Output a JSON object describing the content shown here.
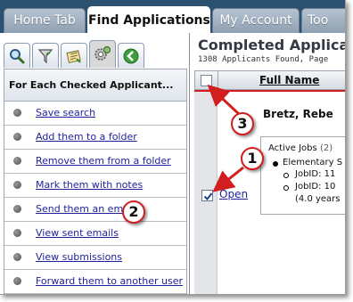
{
  "tabs": [
    {
      "label": "Home Tab",
      "active": false
    },
    {
      "label": "Find Applications",
      "active": true
    },
    {
      "label": "My Account",
      "active": false
    },
    {
      "label": "Too",
      "active": false
    }
  ],
  "toolbar_icons": [
    "search-icon",
    "filter-icon",
    "notes-icon",
    "gears-icon",
    "back-arrow-icon"
  ],
  "panel": {
    "heading": "For Each Checked Applicant...",
    "actions": [
      {
        "label": "Save search"
      },
      {
        "label": "Add them to a folder"
      },
      {
        "label": "Remove them from a folder"
      },
      {
        "label": "Mark them with notes"
      },
      {
        "label": "Send them an email"
      },
      {
        "label": "View sent emails"
      },
      {
        "label": "View submissions"
      },
      {
        "label": "Forward them to another user"
      }
    ]
  },
  "main": {
    "title": "Completed Applicat",
    "subtitle": "1308 Applicants Found, Page",
    "column_header": "Full Name",
    "applicant": {
      "name": "Bretz,  Rebe",
      "open_link": "Open",
      "checked": true,
      "active_jobs_label": "Active Jobs",
      "active_jobs_count": "(2)",
      "job_category": "Elementary S",
      "job_ids": [
        "JobID: 11",
        "JobID: 10"
      ],
      "experience": "(4.0 years"
    }
  },
  "callouts": [
    "1",
    "2",
    "3"
  ],
  "colors": {
    "tabbar": "#2c506f",
    "link": "#1f1f9c",
    "accent_red": "#d21e1e"
  }
}
